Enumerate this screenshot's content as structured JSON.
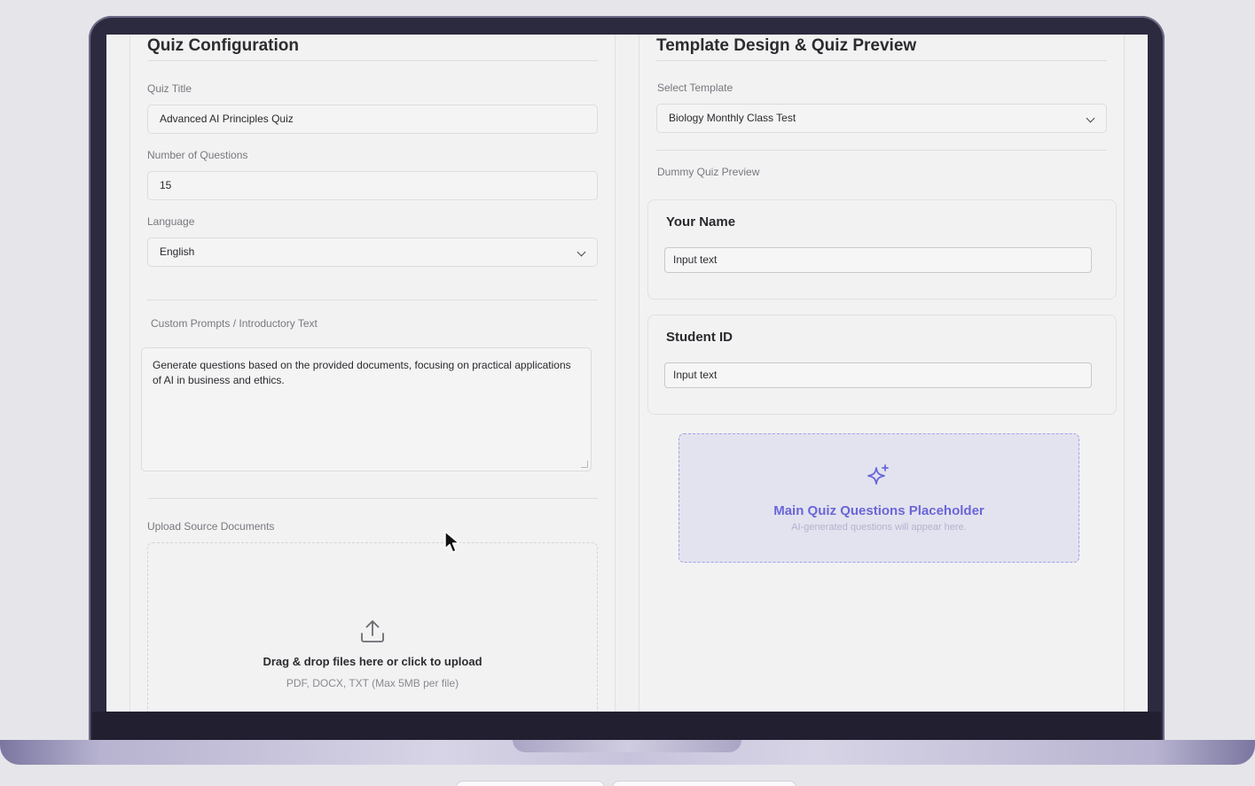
{
  "config": {
    "heading": "Quiz Configuration",
    "quiz_title": {
      "label": "Quiz Title",
      "value": "Advanced AI Principles Quiz"
    },
    "num_questions": {
      "label": "Number of Questions",
      "value": "15"
    },
    "language": {
      "label": "Language",
      "value": "English"
    },
    "custom_prompts": {
      "label": "Custom Prompts / Introductory Text",
      "value": "Generate questions based on the provided documents, focusing on practical applications of AI in business and ethics."
    },
    "upload": {
      "label": "Upload Source Documents",
      "title": "Drag & drop files here or click to upload",
      "hint": "PDF, DOCX, TXT (Max 5MB per file)"
    }
  },
  "template": {
    "heading": "Template Design & Quiz Preview",
    "select_label": "Select Template",
    "selected_template": "Biology Monthly Class Test",
    "preview_label": "Dummy Quiz Preview",
    "cards": [
      {
        "title": "Your Name",
        "placeholder": "Input text"
      },
      {
        "title": "Student ID",
        "placeholder": "Input text"
      }
    ],
    "placeholder": {
      "title": "Main Quiz Questions Placeholder",
      "subtitle": "AI-generated questions will appear here."
    }
  },
  "icons": {
    "upload": "upload-icon",
    "sparkle": "sparkle-icon",
    "chevron": "chevron-down-icon",
    "cursor": "mouse-pointer-icon"
  },
  "colors": {
    "accent": "#6a66d8",
    "frame": "#2c2a3e",
    "screen_bg": "#f1f1f2"
  }
}
